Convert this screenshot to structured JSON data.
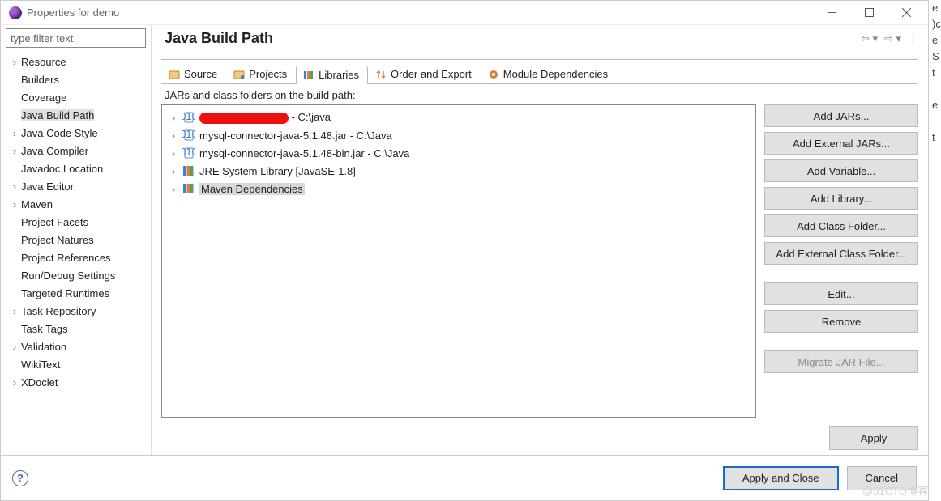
{
  "window": {
    "title": "Properties for demo"
  },
  "filter": {
    "placeholder": "type filter text"
  },
  "tree": [
    {
      "label": "Resource",
      "expandable": true
    },
    {
      "label": "Builders",
      "expandable": false
    },
    {
      "label": "Coverage",
      "expandable": false
    },
    {
      "label": "Java Build Path",
      "expandable": false,
      "selected": true
    },
    {
      "label": "Java Code Style",
      "expandable": true
    },
    {
      "label": "Java Compiler",
      "expandable": true
    },
    {
      "label": "Javadoc Location",
      "expandable": false
    },
    {
      "label": "Java Editor",
      "expandable": true
    },
    {
      "label": "Maven",
      "expandable": true
    },
    {
      "label": "Project Facets",
      "expandable": false
    },
    {
      "label": "Project Natures",
      "expandable": false
    },
    {
      "label": "Project References",
      "expandable": false
    },
    {
      "label": "Run/Debug Settings",
      "expandable": false
    },
    {
      "label": "Targeted Runtimes",
      "expandable": false
    },
    {
      "label": "Task Repository",
      "expandable": true
    },
    {
      "label": "Task Tags",
      "expandable": false
    },
    {
      "label": "Validation",
      "expandable": true
    },
    {
      "label": "WikiText",
      "expandable": false
    },
    {
      "label": "XDoclet",
      "expandable": true
    }
  ],
  "page": {
    "header": "Java Build Path"
  },
  "tabs": [
    {
      "label": "Source",
      "icon": "folder-src-icon"
    },
    {
      "label": "Projects",
      "icon": "folder-prj-icon"
    },
    {
      "label": "Libraries",
      "icon": "library-icon",
      "active": true
    },
    {
      "label": "Order and Export",
      "icon": "order-icon"
    },
    {
      "label": "Module Dependencies",
      "icon": "module-icon"
    }
  ],
  "section": {
    "label": "JARs and class folders on the build path:"
  },
  "entries": [
    {
      "label": " - C:\\java",
      "icon": "jar",
      "redacted": true
    },
    {
      "label": "mysql-connector-java-5.1.48.jar - C:\\Java",
      "icon": "jar"
    },
    {
      "label": "mysql-connector-java-5.1.48-bin.jar - C:\\Java",
      "icon": "jar"
    },
    {
      "label": "JRE System Library [JavaSE-1.8]",
      "icon": "lib"
    },
    {
      "label": "Maven Dependencies",
      "icon": "lib",
      "selected": true
    }
  ],
  "buttons": {
    "add_jars": "Add JARs...",
    "add_external_jars": "Add External JARs...",
    "add_variable": "Add Variable...",
    "add_library": "Add Library...",
    "add_class_folder": "Add Class Folder...",
    "add_external_class_folder": "Add External Class Folder...",
    "edit": "Edit...",
    "remove": "Remove",
    "migrate": "Migrate JAR File..."
  },
  "footer": {
    "apply": "Apply",
    "apply_and_close": "Apply and Close",
    "cancel": "Cancel"
  },
  "watermark": "@51CTO博客"
}
